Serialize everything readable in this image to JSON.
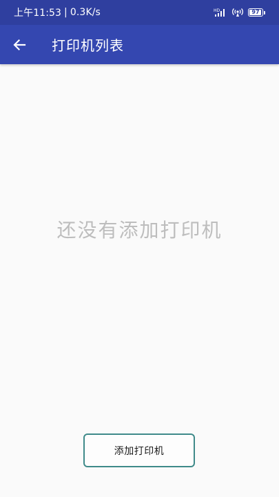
{
  "status_bar": {
    "time": "上午11:53",
    "separator": "|",
    "net_speed": "0.3K/s",
    "network_label": "HD",
    "battery_level": "97",
    "battery_fraction": 0.97,
    "icons": [
      "hd-signal-icon",
      "hotspot-icon",
      "battery-icon"
    ]
  },
  "app_bar": {
    "title": "打印机列表",
    "back_icon": "arrow-back-icon"
  },
  "main": {
    "empty_message": "还没有添加打印机"
  },
  "actions": {
    "add_printer_label": "添加打印机"
  },
  "colors": {
    "status_bar": "#2f3f9f",
    "app_bar": "#3447b0",
    "background": "#fafafa",
    "empty_text": "#bdbdbd",
    "button_border": "#3e8a89"
  }
}
